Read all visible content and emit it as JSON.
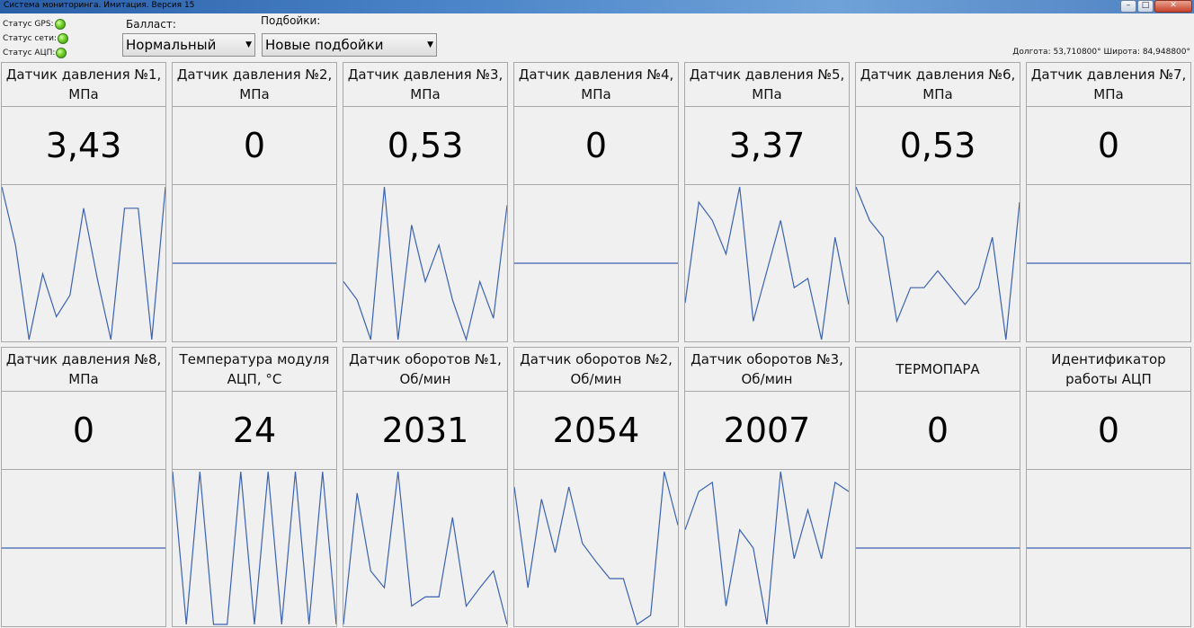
{
  "window": {
    "title": "Система мониторинга. Имитация. Версия 15",
    "buttons": [
      "–",
      "□",
      "✕"
    ]
  },
  "status": [
    {
      "label": "Статус GPS:",
      "icon": "green-led-icon",
      "color": "#5cc21e"
    },
    {
      "label": "Статус сети:",
      "icon": "green-led-icon",
      "color": "#5cc21e"
    },
    {
      "label": "Статус АЦП:",
      "icon": "green-led-icon",
      "color": "#5cc21e"
    }
  ],
  "ballast": {
    "label": "Балласт:",
    "value": "Нормальный"
  },
  "podboiki": {
    "label": "Подбойки:",
    "value": "Новые подбойки"
  },
  "coordinates": "Долгота: 53,710800° Широта: 84,948800°",
  "line_color": "#3a62b0",
  "panels": [
    {
      "title": "Датчик давления №1, МПа",
      "value": "3,43",
      "series": [
        0.0,
        0.38,
        1.0,
        0.57,
        0.85,
        0.71,
        0.14,
        0.6,
        1.0,
        0.14,
        0.14,
        1.0,
        0.0
      ]
    },
    {
      "title": "Датчик давления №2, МПа",
      "value": "0",
      "series": [
        0.5,
        0.5
      ]
    },
    {
      "title": "Датчик давления №3, МПа",
      "value": "0,53",
      "series": [
        0.62,
        0.74,
        1.0,
        0.0,
        1.0,
        0.25,
        0.62,
        0.38,
        0.74,
        1.0,
        0.62,
        0.86,
        0.12
      ]
    },
    {
      "title": "Датчик давления №4, МПа",
      "value": "0",
      "series": [
        0.5,
        0.5
      ]
    },
    {
      "title": "Датчик давления №5, МПа",
      "value": "3,37",
      "series": [
        0.76,
        0.1,
        0.22,
        0.44,
        0.0,
        0.88,
        0.55,
        0.22,
        0.66,
        0.6,
        1.0,
        0.33,
        0.77
      ]
    },
    {
      "title": "Датчик давления №6, МПа",
      "value": "0,53",
      "series": [
        0.0,
        0.22,
        0.33,
        0.88,
        0.66,
        0.66,
        0.55,
        0.66,
        0.77,
        0.66,
        0.33,
        1.0,
        0.1
      ]
    },
    {
      "title": "Датчик давления №7, МПа",
      "value": "0",
      "series": [
        0.5,
        0.5
      ]
    },
    {
      "title": "Датчик давления №8, МПа",
      "value": "0",
      "series": [
        0.5,
        0.5
      ]
    },
    {
      "title": "Температура модуля АЦП, °C",
      "value": "24",
      "series": [
        0.0,
        1.0,
        0.0,
        1.0,
        1.0,
        0.0,
        1.0,
        0.0,
        1.0,
        0.0,
        1.0,
        0.0,
        1.0
      ]
    },
    {
      "title": "Датчик оборотов №1, Об/мин",
      "value": "2031",
      "series": [
        1.0,
        0.14,
        0.65,
        0.76,
        0.0,
        0.88,
        0.82,
        0.82,
        0.3,
        0.88,
        0.76,
        0.65,
        1.0
      ]
    },
    {
      "title": "Датчик оборотов №2, Об/мин",
      "value": "2054",
      "series": [
        0.1,
        0.76,
        0.18,
        0.53,
        0.1,
        0.47,
        0.59,
        0.7,
        0.7,
        1.0,
        0.94,
        0.0,
        0.35
      ]
    },
    {
      "title": "Датчик оборотов №3, Об/мин",
      "value": "2007",
      "series": [
        0.38,
        0.13,
        0.07,
        0.88,
        0.38,
        0.5,
        1.0,
        0.0,
        0.57,
        0.25,
        0.57,
        0.07,
        0.13
      ]
    },
    {
      "title": "ТЕРМОПАРА",
      "value": "0",
      "series": [
        0.5,
        0.5
      ]
    },
    {
      "title": "Идентификатор работы АЦП",
      "value": "0",
      "series": [
        0.5,
        0.5
      ]
    }
  ]
}
